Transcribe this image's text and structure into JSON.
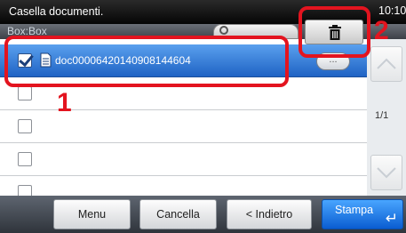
{
  "header": {
    "title": "Casella documenti.",
    "clock": "10:10",
    "box_label": "Box:Box"
  },
  "list": {
    "rows": [
      {
        "name": "doc00006420140908144604",
        "selected": true,
        "detail_label": "..."
      },
      {
        "name": "",
        "selected": false
      },
      {
        "name": "",
        "selected": false
      },
      {
        "name": "",
        "selected": false
      },
      {
        "name": "",
        "selected": false
      }
    ]
  },
  "scroll": {
    "page_indicator": "1/1"
  },
  "footer": {
    "menu_label": "Menu",
    "cancel_label": "Cancella",
    "back_label": "< Indietro",
    "print_label": "Stampa",
    "enter_glyph": "↵"
  },
  "callouts": {
    "one": "1",
    "two": "2"
  },
  "colors": {
    "accent_blue": "#1f63c4",
    "callout_red": "#e3141f"
  },
  "icons": [
    "search-icon",
    "trash-icon",
    "document-icon",
    "chevron-up-icon",
    "chevron-down-icon",
    "enter-icon"
  ]
}
